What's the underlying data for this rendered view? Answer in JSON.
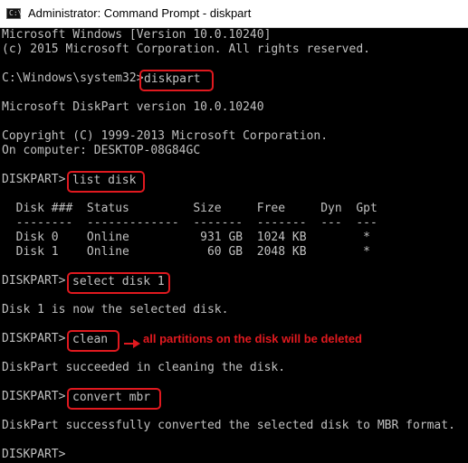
{
  "window": {
    "title": "Administrator: Command Prompt - diskpart",
    "icon": "cmd-app-icon"
  },
  "console": {
    "lines": [
      "Microsoft Windows [Version 10.0.10240]",
      "(c) 2015 Microsoft Corporation. All rights reserved.",
      "",
      "C:\\Windows\\system32>",
      "",
      "Microsoft DiskPart version 10.0.10240",
      "",
      "Copyright (C) 1999-2013 Microsoft Corporation.",
      "On computer: DESKTOP-08G84GC",
      "",
      "DISKPART>",
      "",
      "  Disk ###  Status         Size     Free     Dyn  Gpt",
      "  --------  -------------  -------  -------  ---  ---",
      "  Disk 0    Online          931 GB  1024 KB        *",
      "  Disk 1    Online           60 GB  2048 KB        *",
      "",
      "DISKPART>",
      "",
      "Disk 1 is now the selected disk.",
      "",
      "DISKPART>",
      "",
      "DiskPart succeeded in cleaning the disk.",
      "",
      "DISKPART>",
      "",
      "DiskPart successfully converted the selected disk to MBR format.",
      "",
      "DISKPART>"
    ],
    "commands": {
      "diskpart": "diskpart",
      "list_disk": "list disk",
      "select_disk": "select disk 1",
      "clean": "clean",
      "convert_mbr": "convert mbr"
    }
  },
  "annotation": {
    "note": "all partitions on the disk will be deleted",
    "color": "#e0191f"
  }
}
